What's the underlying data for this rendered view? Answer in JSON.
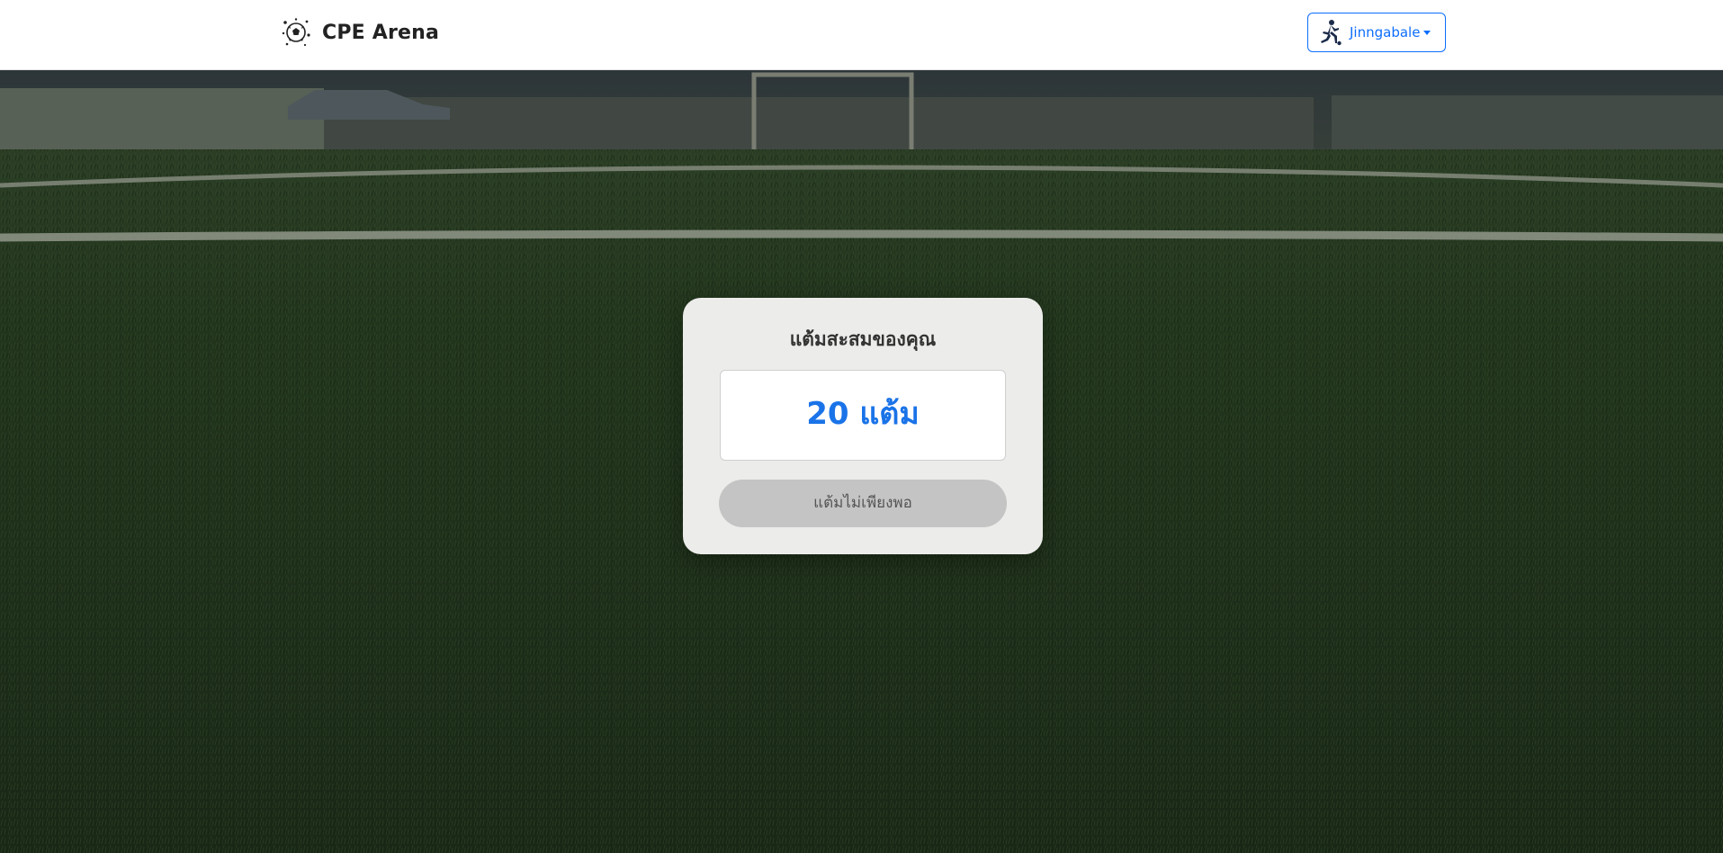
{
  "navbar": {
    "brand_name": "CPE Arena",
    "brand_icon": "soccer-ball-icon",
    "user": {
      "name": "Jinngabale",
      "avatar_icon": "soccer-player-icon",
      "dropdown_icon": "caret-down-icon"
    }
  },
  "points_card": {
    "title": "แต้มสะสมของคุณ",
    "points_display": "20 แต้ม",
    "points": 20,
    "button_label": "แต้มไม่เพียงพอ",
    "button_disabled": true
  },
  "background": {
    "scene": "artificial-turf-soccer-field"
  },
  "colors": {
    "accent": "#0d6efd",
    "points_text": "#1a73e8",
    "disabled_button": "#c4c4c4",
    "card_bg": "#ececea"
  }
}
